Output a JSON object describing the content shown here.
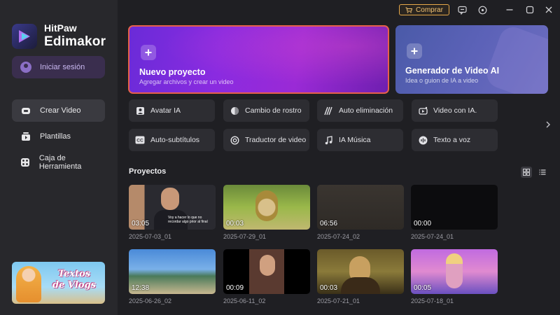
{
  "app": {
    "brand_line1": "HitPaw",
    "brand_line2": "Edimakor",
    "login_label": "Iniciar sesión",
    "buy_label": "Comprar"
  },
  "sidebar": {
    "items": [
      {
        "label": "Crear Video",
        "icon": "create-video-icon",
        "active": true
      },
      {
        "label": "Plantillas",
        "icon": "templates-icon",
        "active": false
      },
      {
        "label": "Caja de Herramienta",
        "icon": "toolbox-icon",
        "active": false
      }
    ],
    "promo_text_line1": "Textos",
    "promo_text_line2": "de Vlogs"
  },
  "hero": {
    "new_project": {
      "title": "Nuevo proyecto",
      "subtitle": "Agregar archivos y crear un video"
    },
    "ai_generator": {
      "title": "Generador de Video AI",
      "subtitle": "Idea o guion de IA a video"
    }
  },
  "tools": [
    {
      "label": "Avatar IA",
      "icon": "avatar-icon"
    },
    {
      "label": "Cambio de rostro",
      "icon": "face-swap-icon"
    },
    {
      "label": "Auto eliminación",
      "icon": "auto-remove-icon"
    },
    {
      "label": "Video con IA.",
      "icon": "ai-video-icon"
    },
    {
      "label": "Auto-subtítulos",
      "icon": "cc-icon"
    },
    {
      "label": "Traductor de video",
      "icon": "translate-icon"
    },
    {
      "label": "IA Música",
      "icon": "music-icon"
    },
    {
      "label": "Texto a voz",
      "icon": "text-to-speech-icon"
    }
  ],
  "projects_section": {
    "title": "Proyectos"
  },
  "projects": [
    {
      "duration": "03:05",
      "date": "2025-07-03_01",
      "caption": "Voy a hacer lo que no recordar algo prior al final"
    },
    {
      "duration": "00:03",
      "date": "2025-07-29_01"
    },
    {
      "duration": "06:56",
      "date": "2025-07-24_02"
    },
    {
      "duration": "00:00",
      "date": "2025-07-24_01"
    },
    {
      "duration": "12:38",
      "date": "2025-06-26_02"
    },
    {
      "duration": "00:09",
      "date": "2025-06-11_02"
    },
    {
      "duration": "00:03",
      "date": "2025-07-21_01"
    },
    {
      "duration": "00:05",
      "date": "2025-07-18_01"
    }
  ],
  "colors": {
    "background": "#1f1f23",
    "sidebar": "#28282c",
    "accent_purple": "#8a2be0",
    "highlight_border": "#e6604a",
    "buy_border": "#e7a94a"
  }
}
